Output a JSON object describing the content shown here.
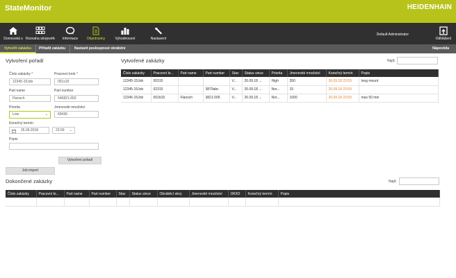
{
  "header": {
    "app_title": "StateMonitor",
    "brand": "HEIDENHAIN"
  },
  "nav": {
    "items": [
      {
        "label": "Domovská s",
        "icon": "home-icon"
      },
      {
        "label": "Rozvaha strojového p.",
        "icon": "grid-icon"
      },
      {
        "label": "Informace",
        "icon": "chat-icon"
      },
      {
        "label": "Objednávky",
        "icon": "document-icon"
      },
      {
        "label": "Vyhodnocení",
        "icon": "bar-chart-icon"
      },
      {
        "label": "Nastavení",
        "icon": "wrench-icon"
      }
    ],
    "user": "Default Administrator",
    "logout": "Odhlášení"
  },
  "subnav": {
    "tabs": [
      "Vytvořit zakázku",
      "Přiřadit zakázku",
      "Nastavit posloupnost obrábění"
    ],
    "help": "Nápověda"
  },
  "form": {
    "title": "Vytvoření pořadí",
    "order_no_label": "Číslo zakázky",
    "order_no_value": "12345-15Job",
    "step_label": "Pracovní krok",
    "step_value": "001s15",
    "part_name_label": "Part name",
    "part_name_value": "Flansch",
    "part_number_label": "Part number",
    "part_number_value": "546821-002",
    "priority_label": "Priorita",
    "priority_value": "Low",
    "nominal_qty_label": "Jmenovité množství",
    "nominal_qty_value": "69436",
    "due_label": "Konečný termín",
    "due_date": "26.09.2018",
    "due_time": "23:59",
    "desc_label": "Popis",
    "desc_value": "",
    "create_button": "Vytvoření pořadí",
    "import_button": "Job import"
  },
  "created": {
    "title": "Vytvořené zakázky",
    "search_label": "Najít:",
    "columns": [
      "Číslo zakázky",
      "Pracovní kr...",
      "Part name",
      "Part number",
      "Stav",
      "Status since",
      "Priorita",
      "Jmenovité množství",
      "Konečný termín",
      "Popis"
    ],
    "rows": [
      [
        "12345-15Job",
        "00315",
        "",
        "",
        "V...",
        "26.09.18 ...",
        "High",
        "350",
        "26.09.18 23:59",
        "long mount"
      ],
      [
        "12345-15Job",
        "02315",
        "",
        "3879abc",
        "V...",
        "26.09.18 ...",
        "Nor...",
        "15",
        "26.09.18 23:59",
        ""
      ],
      [
        "12345-15Job",
        "001b15",
        "Flansch",
        "3821-005",
        "V...",
        "26.09.18 ...",
        "Nor...",
        "1000",
        "26.09.18 23:59",
        "max 50 min"
      ]
    ]
  },
  "finished": {
    "title": "Dokončené zakázky",
    "search_label": "Najít:",
    "columns": [
      "Číslo zakázky",
      "Pracovní kr...",
      "Part name",
      "Part number",
      "Stav",
      "Status since",
      "Obráběcí stroj",
      "Jmenovité množství",
      "OK/IO",
      "Konečný termín",
      "Popis"
    ]
  },
  "colors": {
    "accent": "#b7c31a",
    "nav_bg": "#303030",
    "subnav_bg": "#5a5a5a",
    "due_orange": "#e8822b"
  }
}
